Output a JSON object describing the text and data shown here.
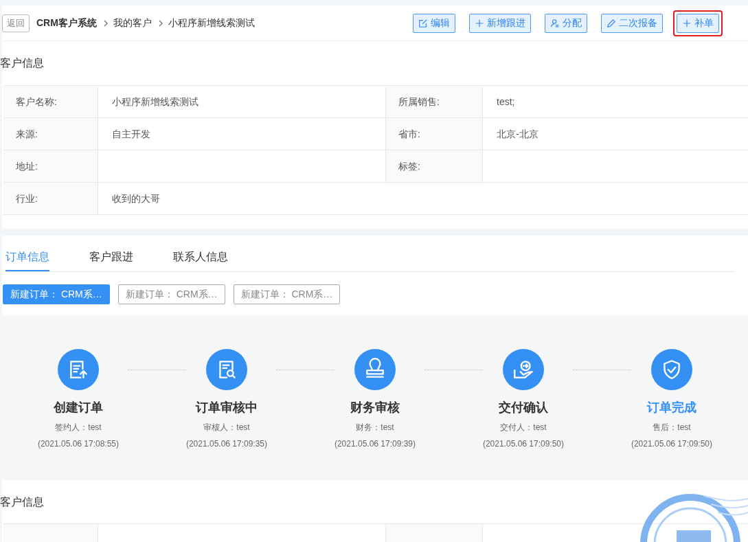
{
  "header": {
    "back": "返回",
    "breadcrumb": [
      {
        "label": "CRM客户系统",
        "bold": true
      },
      {
        "label": "我的客户",
        "bold": false
      },
      {
        "label": "小程序新增线索测试",
        "bold": false
      }
    ],
    "actions": [
      {
        "label": "编辑",
        "kind": "edit",
        "highlighted": false
      },
      {
        "label": "新增跟进",
        "kind": "add",
        "highlighted": false
      },
      {
        "label": "分配",
        "kind": "assign",
        "highlighted": false
      },
      {
        "label": "二次报备",
        "kind": "report",
        "highlighted": false
      },
      {
        "label": "补单",
        "kind": "add",
        "highlighted": true
      }
    ]
  },
  "customer_info": {
    "title": "客户信息",
    "rows": [
      [
        {
          "label": "客户名称:",
          "value": "小程序新增线索测试"
        },
        {
          "label": "所属销售:",
          "value": "test;"
        }
      ],
      [
        {
          "label": "来源:",
          "value": "自主开发"
        },
        {
          "label": "省市:",
          "value": "北京-北京"
        }
      ],
      [
        {
          "label": "地址:"
        },
        {
          "label": "标签:"
        }
      ],
      [
        {
          "label": "行业:",
          "value": "收到的大哥"
        }
      ]
    ]
  },
  "tabs": [
    {
      "label": "订单信息",
      "selected": true
    },
    {
      "label": "客户跟进",
      "selected": false
    },
    {
      "label": "联系人信息",
      "selected": false
    }
  ],
  "orders": [
    {
      "label": "新建订单： CRM系…",
      "selected": true
    },
    {
      "label": "新建订单： CRM系…",
      "selected": false
    },
    {
      "label": "新建订单： CRM系…",
      "selected": false
    }
  ],
  "steps": [
    {
      "kind": "create",
      "title": "创建订单",
      "person": "签约人：test",
      "time": "(2021.05.06 17:08:55)",
      "current": false
    },
    {
      "kind": "review",
      "title": "订单审核中",
      "person": "审核人：test",
      "time": "(2021.05.06 17:09:35)",
      "current": false
    },
    {
      "kind": "finance",
      "title": "财务审核",
      "person": "财务：test",
      "time": "(2021.05.06 17:09:39)",
      "current": false
    },
    {
      "kind": "delivery",
      "title": "交付确认",
      "person": "交付人：test",
      "time": "(2021.05.06 17:09:50)",
      "current": false
    },
    {
      "kind": "done",
      "title": "订单完成",
      "person": "售后：test",
      "time": "(2021.05.06 17:09:50)",
      "current": true
    }
  ],
  "contact_info": {
    "title": "客户信息"
  }
}
